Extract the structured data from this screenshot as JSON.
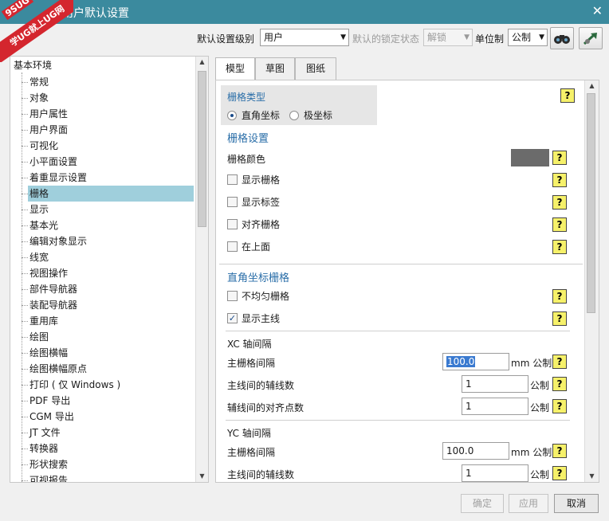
{
  "window": {
    "title": "用户默认设置",
    "close_glyph": "✕"
  },
  "watermark": {
    "line1": "9SUG",
    "line2": "学UG就上UG网"
  },
  "toolbar": {
    "level_label": "默认设置级别",
    "level_value": "用户",
    "lock_label": "默认的锁定状态",
    "lock_value": "解锁",
    "units_label": "单位制",
    "units_value": "公制",
    "find_icon": "binoculars-icon",
    "apply_icon": "arrow-icon"
  },
  "tree": {
    "root": "基本环境",
    "items": [
      "常规",
      "对象",
      "用户属性",
      "用户界面",
      "可视化",
      "小平面设置",
      "着重显示设置",
      "栅格",
      "显示",
      "基本光",
      "编辑对象显示",
      "线宽",
      "视图操作",
      "部件导航器",
      "装配导航器",
      "重用库",
      "绘图",
      "绘图横幅",
      "绘图横幅原点",
      "打印 ( 仅 Windows )",
      "PDF 导出",
      "CGM 导出",
      "JT 文件",
      "转换器",
      "形状搜索",
      "可视报告"
    ],
    "selected_index": 7
  },
  "tabs": [
    "模型",
    "草图",
    "图纸"
  ],
  "content": {
    "grid_type": {
      "title": "栅格类型",
      "options": [
        "直角坐标",
        "极坐标"
      ],
      "selected": 0
    },
    "grid_settings": {
      "title": "栅格设置",
      "color_label": "栅格颜色",
      "color_value": "#6b6b6b",
      "checks": [
        {
          "label": "显示栅格",
          "checked": false
        },
        {
          "label": "显示标签",
          "checked": false
        },
        {
          "label": "对齐栅格",
          "checked": false
        },
        {
          "label": "在上面",
          "checked": false
        }
      ]
    },
    "rect_grid": {
      "title": "直角坐标栅格",
      "checks": [
        {
          "label": "不均匀栅格",
          "checked": false
        },
        {
          "label": "显示主线",
          "checked": true
        }
      ],
      "xc": {
        "title": "XC 轴间隔",
        "main_spacing_label": "主栅格间隔",
        "main_spacing_value": "100.0",
        "main_spacing_unit": "mm 公制",
        "minor_lines_label": "主线间的辅线数",
        "minor_lines_value": "1",
        "minor_lines_unit": "公制",
        "snap_points_label": "辅线间的对齐点数",
        "snap_points_value": "1",
        "snap_points_unit": "公制"
      },
      "yc": {
        "title": "YC 轴间隔",
        "main_spacing_label": "主栅格间隔",
        "main_spacing_value": "100.0",
        "main_spacing_unit": "mm 公制",
        "minor_lines_label": "主线间的辅线数",
        "minor_lines_value": "1",
        "minor_lines_unit": "公制"
      }
    },
    "help_glyph": "?"
  },
  "buttons": {
    "ok": "确定",
    "apply": "应用",
    "cancel": "取消"
  }
}
